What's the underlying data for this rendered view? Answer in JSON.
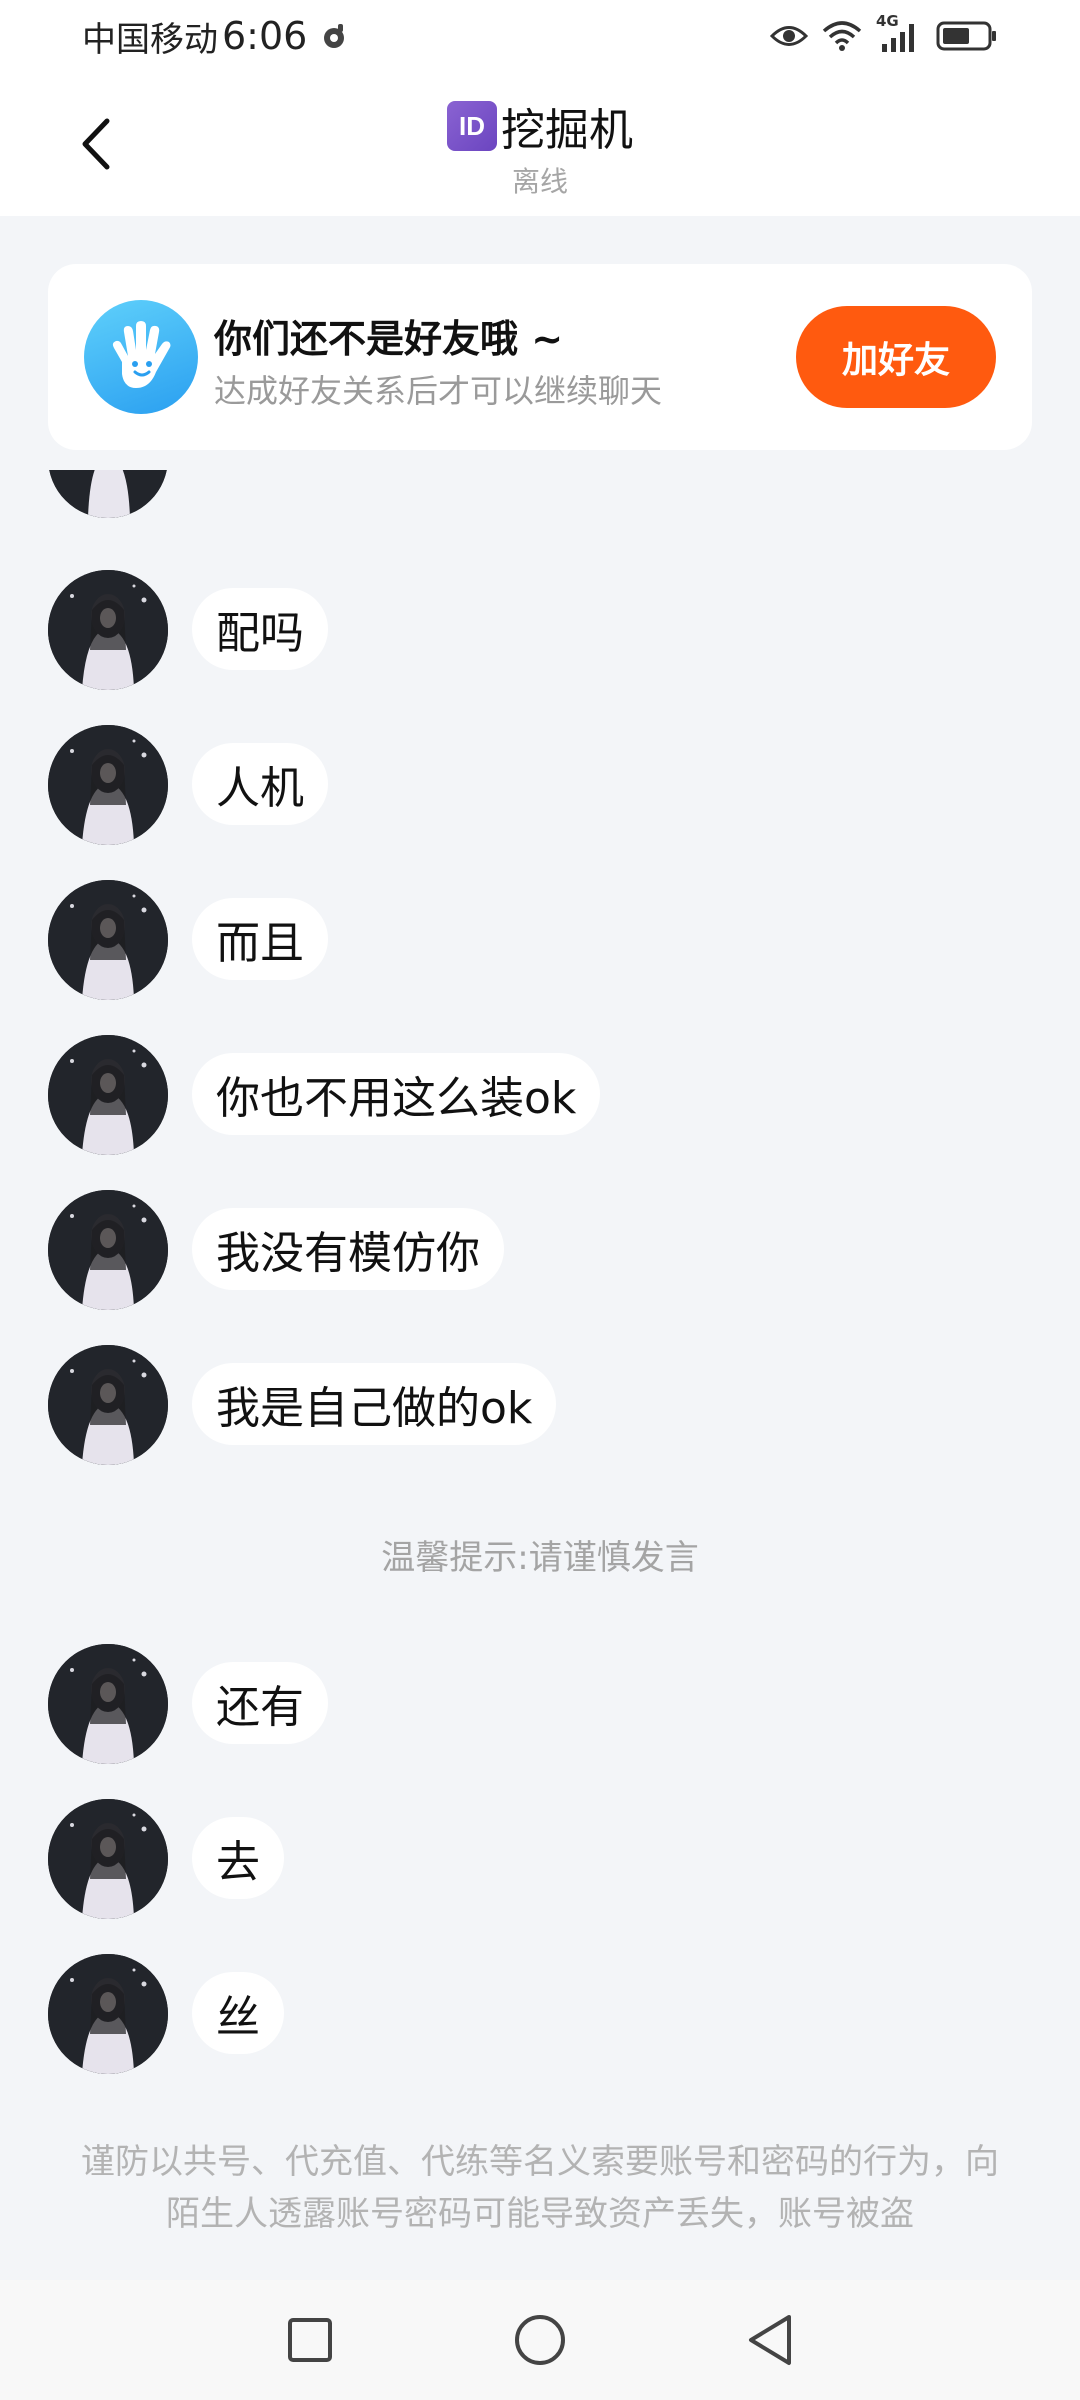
{
  "status_bar": {
    "carrier": "中国移动",
    "time": "6:06",
    "network": "4G"
  },
  "header": {
    "id_badge": "ID",
    "title": "挖掘机",
    "status": "离线"
  },
  "friend_card": {
    "title": "你们还不是好友哦 ~",
    "description": "达成好友关系后才可以继续聊天",
    "add_button": "加好友"
  },
  "messages": [
    {
      "text": "配吗"
    },
    {
      "text": "人机"
    },
    {
      "text": "而且"
    },
    {
      "text": "你也不用这么装ok"
    },
    {
      "text": "我没有模仿你"
    },
    {
      "text": "我是自己做的ok"
    },
    {
      "text": "还有"
    },
    {
      "text": "去"
    },
    {
      "text": "丝"
    }
  ],
  "tip": "温馨提示:请谨慎发言",
  "warning": "谨防以共号、代充值、代练等名义索要账号和密码的行为，向陌生人透露账号密码可能导致资产丢失，账号被盗",
  "colors": {
    "accent": "#ff5a0f",
    "background": "#f3f5f8",
    "friend_avatar": "#2a9ff0"
  },
  "icons": {
    "back": "chevron-left-icon",
    "eye": "eye-icon",
    "wifi": "wifi-icon",
    "signal": "signal-icon",
    "battery": "battery-icon",
    "hand": "waving-hand-icon",
    "nav_recent": "square-icon",
    "nav_home": "circle-icon",
    "nav_back": "triangle-back-icon"
  }
}
